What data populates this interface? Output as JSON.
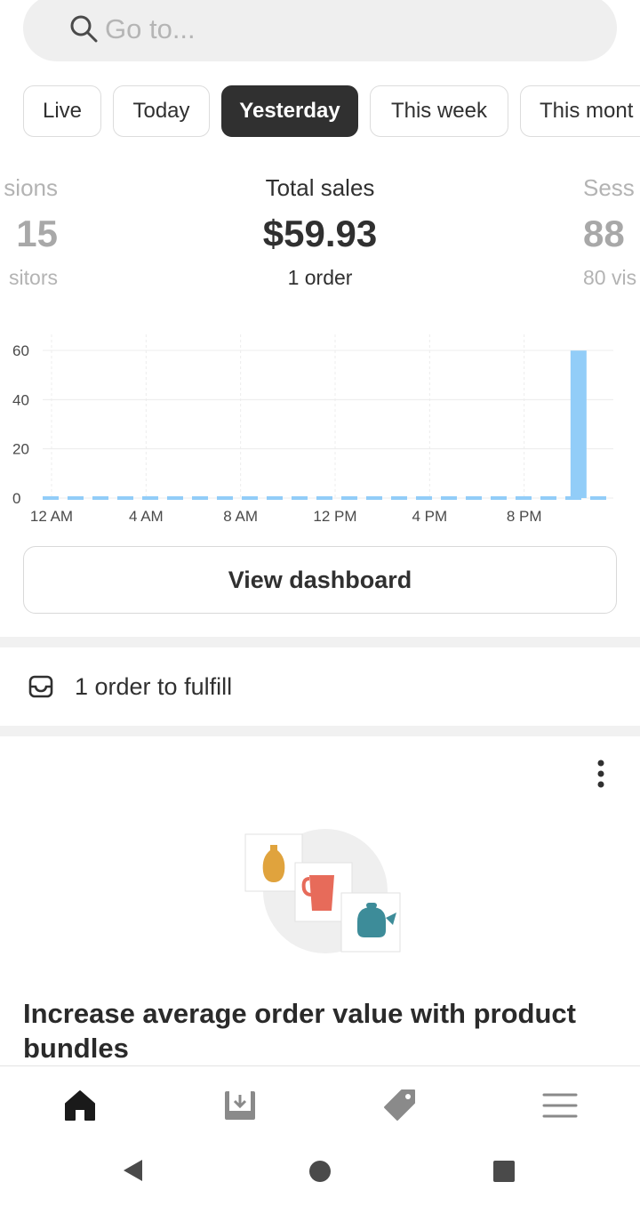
{
  "search": {
    "placeholder": "Go to..."
  },
  "date_tabs": [
    "Live",
    "Today",
    "Yesterday",
    "This week",
    "This mont"
  ],
  "active_tab": "Yesterday",
  "metrics": {
    "left": {
      "label": "sions",
      "value": "15",
      "sub": "sitors"
    },
    "center": {
      "label": "Total sales",
      "value": "$59.93",
      "sub": "1 order"
    },
    "right": {
      "label": "Sess",
      "value": "88",
      "sub": "80 vis"
    }
  },
  "chart_data": {
    "type": "bar",
    "y_ticks": [
      "60",
      "40",
      "20",
      "0"
    ],
    "ylim": [
      0,
      60
    ],
    "x_ticks": [
      "12 AM",
      "4 AM",
      "8 AM",
      "12 PM",
      "4 PM",
      "8 PM"
    ],
    "hours": [
      0,
      1,
      2,
      3,
      4,
      5,
      6,
      7,
      8,
      9,
      10,
      11,
      12,
      13,
      14,
      15,
      16,
      17,
      18,
      19,
      20,
      21,
      22,
      23
    ],
    "values": [
      0,
      0,
      0,
      0,
      0,
      0,
      0,
      0,
      0,
      0,
      0,
      0,
      0,
      0,
      0,
      0,
      0,
      0,
      0,
      0,
      0,
      0,
      59.93,
      0
    ],
    "comparison_line": "dashed",
    "grid": true,
    "colors": {
      "bar": "#92cdf8",
      "comparison": "#92cdf8",
      "grid": "#ececec"
    }
  },
  "dashboard_button": "View dashboard",
  "fulfill_text": "1 order to fulfill",
  "card": {
    "title": "Increase average order value with product bundles"
  },
  "nav_icons": [
    "home-icon",
    "orders-icon",
    "products-tag-icon",
    "menu-icon"
  ],
  "system_icons": [
    "back-icon",
    "home-circle-icon",
    "recents-square-icon"
  ]
}
